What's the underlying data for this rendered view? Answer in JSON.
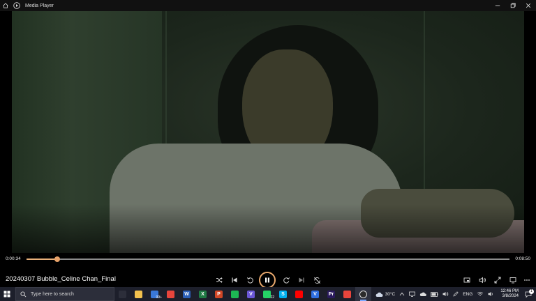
{
  "window": {
    "title": "Media Player"
  },
  "colors": {
    "accent": "#e8a36a",
    "taskbar": "#1d1f2b",
    "video_bg": "#1c261c"
  },
  "player": {
    "current_time": "0:00:34",
    "total_time": "0:08:50",
    "progress": 0.064,
    "media_title": "20240307 Bubble_Celine Chan_Final",
    "state": "playing"
  },
  "controls": {
    "left": [
      "shuffle-icon",
      "previous-icon",
      "rewind-10-icon"
    ],
    "center": "pause-icon",
    "right": [
      "forward-30-icon",
      "next-icon",
      "repeat-off-icon"
    ],
    "far_right": [
      "miniplayer-icon",
      "volume-icon",
      "fullscreen-icon",
      "cast-icon",
      "more-icon"
    ]
  },
  "taskbar": {
    "search_placeholder": "Type here to search",
    "apps": [
      {
        "name": "task-view",
        "label": "",
        "color": "#2c2e3a"
      },
      {
        "name": "file-explorer",
        "label": "",
        "color": "#f2c14e"
      },
      {
        "name": "mail",
        "label": "",
        "color": "#3a78d8",
        "badge": "99+"
      },
      {
        "name": "chrome",
        "label": "",
        "color": "#e8453c"
      },
      {
        "name": "word",
        "label": "W",
        "color": "#2b5fb7"
      },
      {
        "name": "excel",
        "label": "X",
        "color": "#1f7a44"
      },
      {
        "name": "powerpoint",
        "label": "P",
        "color": "#d24726"
      },
      {
        "name": "spotify",
        "label": "",
        "color": "#1db954"
      },
      {
        "name": "viber",
        "label": "V",
        "color": "#6b57d8"
      },
      {
        "name": "whatsapp",
        "label": "",
        "color": "#25d366",
        "badge": "22"
      },
      {
        "name": "skype",
        "label": "S",
        "color": "#00aff0"
      },
      {
        "name": "youtube",
        "label": "",
        "color": "#ff0000"
      },
      {
        "name": "vpn",
        "label": "V",
        "color": "#2f6fe0"
      },
      {
        "name": "premiere",
        "label": "Pr",
        "color": "#2a1a5e"
      },
      {
        "name": "chrome-2",
        "label": "",
        "color": "#e8453c"
      },
      {
        "name": "media-player",
        "label": "",
        "color": "#2b2b2b",
        "active": true
      }
    ]
  },
  "tray": {
    "weather": "30°C",
    "language": "ENG",
    "time": "12:46 PM",
    "date": "3/8/2024",
    "notifications": "1"
  }
}
